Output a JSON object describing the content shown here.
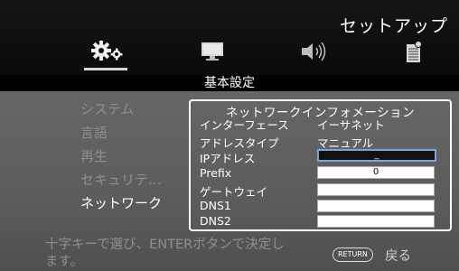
{
  "header": {
    "title": "セットアップ"
  },
  "tabs": [
    {
      "icon": "gear-icon",
      "active": true
    },
    {
      "icon": "monitor-icon"
    },
    {
      "icon": "speaker-icon"
    },
    {
      "icon": "document-icon"
    }
  ],
  "section": {
    "title": "基本設定"
  },
  "menu": {
    "items": [
      {
        "label": "システム"
      },
      {
        "label": "言語"
      },
      {
        "label": "再生"
      },
      {
        "label": "セキュリテ..."
      },
      {
        "label": "ネットワーク"
      }
    ],
    "active_index": 4
  },
  "network": {
    "title": "ネットワークインフォメーション",
    "rows": {
      "interface": {
        "label": "インターフェース",
        "value": "イーサネット"
      },
      "address_type": {
        "label": "アドレスタイプ",
        "value": "マニュアル"
      },
      "ip": {
        "label": "IPアドレス",
        "value": "_"
      },
      "prefix": {
        "label": "Prefix",
        "value": "0"
      },
      "gateway": {
        "label": "ゲートウェイ",
        "value": ""
      },
      "dns1": {
        "label": "DNS1",
        "value": ""
      },
      "dns2": {
        "label": "DNS2",
        "value": ""
      }
    }
  },
  "footer": {
    "hint": "十字キーで選び、ENTERボタンで決定します。",
    "return_button": "RETURN",
    "back_label": "戻る"
  }
}
